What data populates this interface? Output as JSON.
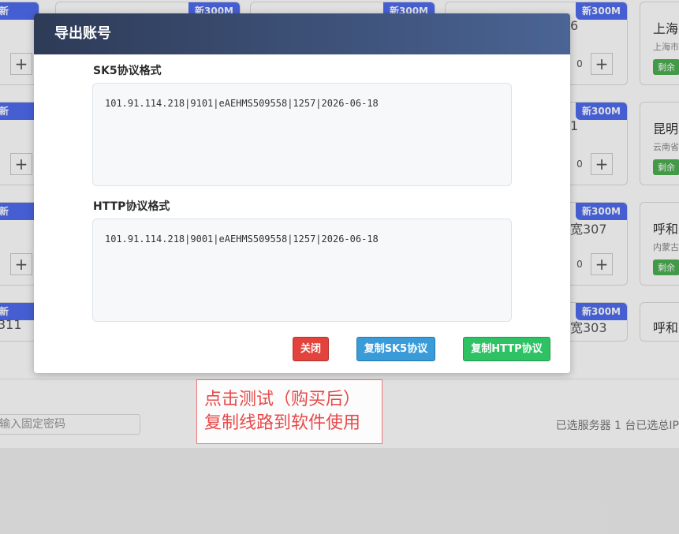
{
  "background": {
    "badge_text": "新300M",
    "stepper_value": "0",
    "plus_symbol": "+",
    "card_partial_texts": [
      "6",
      "1",
      "宽307",
      "宽303",
      "311"
    ],
    "right_cards": [
      {
        "title": "上海",
        "subtitle": "上海市",
        "remain": "剩余"
      },
      {
        "title": "昆明",
        "subtitle": "云南省",
        "remain": "剩余"
      },
      {
        "title": "呼和",
        "subtitle": "内蒙古",
        "remain": "剩余"
      },
      {
        "title": "呼和",
        "subtitle": "",
        "remain": ""
      }
    ],
    "password_placeholder": "输入固定密码",
    "selected_info": "已选服务器 1 台已选总IP"
  },
  "modal": {
    "title": "导出账号",
    "sk5_label": "SK5协议格式",
    "sk5_content": "101.91.114.218|9101|eAEHMS509558|1257|2026-06-18",
    "http_label": "HTTP协议格式",
    "http_content": "101.91.114.218|9001|eAEHMS509558|1257|2026-06-18",
    "buttons": {
      "close": "关闭",
      "copy_sk5": "复制SK5协议",
      "copy_http": "复制HTTP协议"
    }
  },
  "annotation": {
    "line1": "点击测试（购买后）",
    "line2": "复制线路到软件使用"
  }
}
